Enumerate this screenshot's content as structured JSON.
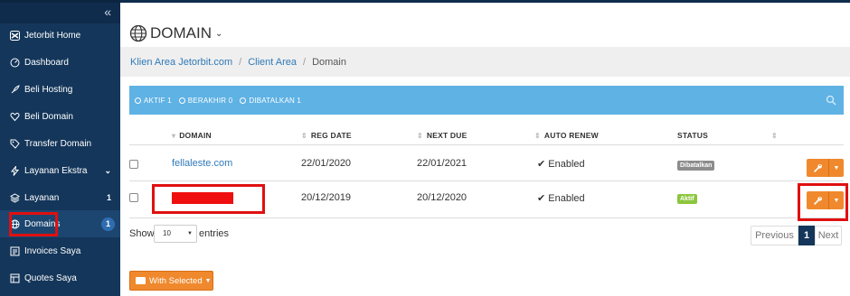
{
  "sidebar": {
    "collapse_icon": "«",
    "items": [
      {
        "label": "Jetorbit Home",
        "icon": "jetorbit-logo-icon",
        "right": ""
      },
      {
        "label": "Dashboard",
        "icon": "dashboard-icon",
        "right": ""
      },
      {
        "label": "Beli Hosting",
        "icon": "rocket-icon",
        "right": ""
      },
      {
        "label": "Beli Domain",
        "icon": "heart-icon",
        "right": ""
      },
      {
        "label": "Transfer Domain",
        "icon": "tag-icon",
        "right": ""
      },
      {
        "label": "Layanan Ekstra",
        "icon": "bolt-icon",
        "right": "⌄"
      },
      {
        "label": "Layanan",
        "icon": "layers-icon",
        "right": "1"
      },
      {
        "label": "Domains",
        "icon": "globe-icon",
        "right": "1"
      },
      {
        "label": "Invoices Saya",
        "icon": "invoice-icon",
        "right": ""
      },
      {
        "label": "Quotes Saya",
        "icon": "quote-icon",
        "right": ""
      }
    ]
  },
  "header": {
    "title": "DOMAIN",
    "caret": "⌄"
  },
  "breadcrumb": {
    "items": [
      "Klien Area Jetorbit.com",
      "Client Area"
    ],
    "current": "Domain",
    "separator": "/"
  },
  "filters": [
    {
      "label": "AKTIF",
      "count": "1"
    },
    {
      "label": "BERAKHIR",
      "count": "0"
    },
    {
      "label": "DIBATALKAN",
      "count": "1"
    }
  ],
  "table": {
    "columns": [
      "DOMAIN",
      "REG DATE",
      "NEXT DUE",
      "AUTO RENEW",
      "STATUS"
    ],
    "rows": [
      {
        "domain": "fellaleste.com",
        "reg_date": "22/01/2020",
        "next_due": "22/01/2021",
        "auto_renew": "Enabled",
        "status": "Dibatalkan",
        "status_color": "#8c8c8c"
      },
      {
        "domain": "",
        "reg_date": "20/12/2019",
        "next_due": "20/12/2020",
        "auto_renew": "Enabled",
        "status": "Aktif",
        "status_color": "#8cc63e"
      }
    ]
  },
  "footer": {
    "show_label": "Show",
    "entries_value": "10",
    "entries_label": "entries",
    "pagination": {
      "prev": "Previous",
      "page": "1",
      "next": "Next"
    },
    "with_selected": "With Selected"
  },
  "colors": {
    "sidebar": "#14365a",
    "filter_bar": "#5fb2e4",
    "accent": "#f0892d",
    "link": "#2f7ab8",
    "highlight": "#e01010"
  }
}
